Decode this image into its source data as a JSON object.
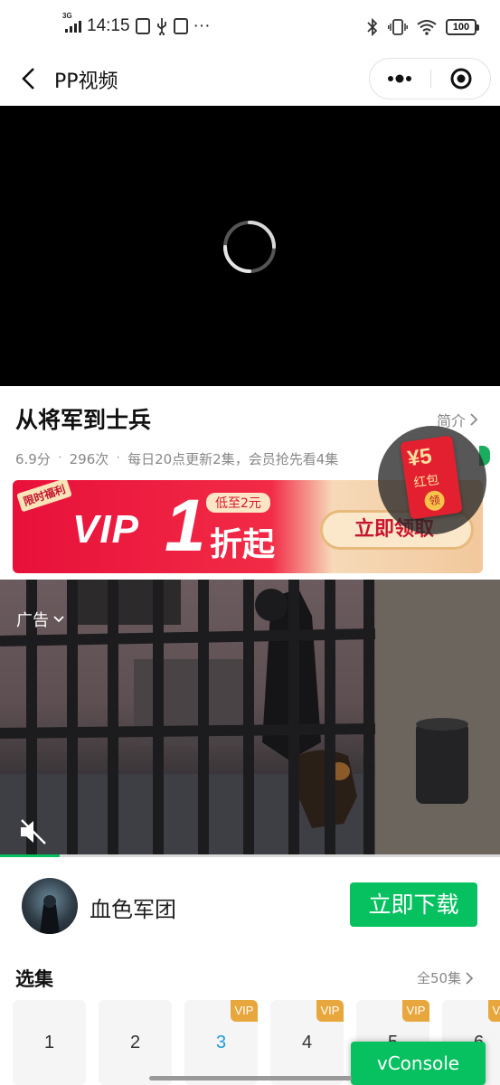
{
  "status_bar": {
    "network": "3G",
    "time": "14:15",
    "more": "···",
    "battery": "100"
  },
  "title_bar": {
    "title": "PP视频"
  },
  "show": {
    "title": "从将军到士兵",
    "intro_label": "简介",
    "score": "6.9分",
    "plays": "296次",
    "update_info": "每日20点更新2集，会员抢先看4集"
  },
  "vip_banner": {
    "flag": "限时福利",
    "vip": "VIP",
    "number": "1",
    "low_badge": "低至2元",
    "discount": "折起",
    "button": "立即领取"
  },
  "red_packet": {
    "amount": "¥5",
    "label": "红包",
    "claim": "领"
  },
  "ad": {
    "label": "广告",
    "progress": 0.12,
    "advertiser": "血色军团",
    "download_button": "立即下载"
  },
  "episodes": {
    "title": "选集",
    "total": "全50集",
    "items": [
      {
        "num": "1",
        "vip": ""
      },
      {
        "num": "2",
        "vip": ""
      },
      {
        "num": "3",
        "vip": "VIP"
      },
      {
        "num": "4",
        "vip": "VIP"
      },
      {
        "num": "5",
        "vip": "VIP"
      },
      {
        "num": "6",
        "vip": "VIP"
      }
    ]
  },
  "vconsole": "vConsole",
  "colors": {
    "accent": "#07c160",
    "vip_red": "#e8103a",
    "vip_tag": "#e8a73d",
    "active_episode": "#1f9be0"
  }
}
